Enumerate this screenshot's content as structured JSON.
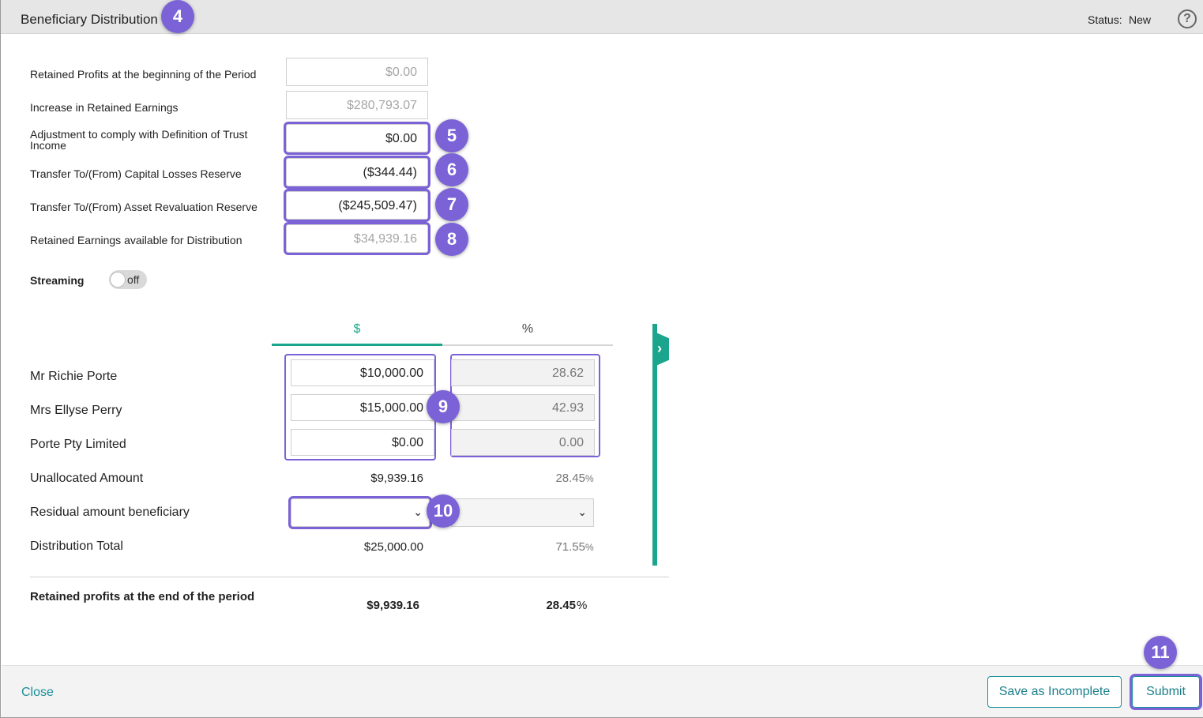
{
  "header": {
    "title": "Beneficiary Distribution",
    "status_label": "Status:",
    "status_value": "New",
    "help_glyph": "?"
  },
  "badges": {
    "b4": "4",
    "b5": "5",
    "b6": "6",
    "b7": "7",
    "b8": "8",
    "b9": "9",
    "b10": "10",
    "b11": "11"
  },
  "summary": {
    "retained_begin_label": "Retained Profits at the beginning of the Period",
    "retained_begin_value": "$0.00",
    "increase_label": "Increase in Retained Earnings",
    "increase_value": "$280,793.07",
    "adjustment_label": "Adjustment to comply with Definition of Trust Income",
    "adjustment_value": "$0.00",
    "capital_losses_label": "Transfer To/(From) Capital Losses Reserve",
    "capital_losses_value": "($344.44)",
    "asset_reval_label": "Transfer To/(From) Asset Revaluation Reserve",
    "asset_reval_value": "($245,509.47)",
    "available_label": "Retained Earnings available for Distribution",
    "available_value": "$34,939.16"
  },
  "streaming": {
    "label": "Streaming",
    "state": "off"
  },
  "tabs": {
    "dollar": "$",
    "percent": "%"
  },
  "beneficiaries": [
    {
      "name": "Mr Richie Porte",
      "amount": "$10,000.00",
      "percent": "28.62"
    },
    {
      "name": "Mrs Ellyse Perry",
      "amount": "$15,000.00",
      "percent": "42.93"
    },
    {
      "name": "Porte Pty Limited",
      "amount": "$0.00",
      "percent": "0.00"
    }
  ],
  "totals": {
    "unallocated_label": "Unallocated Amount",
    "unallocated_amount": "$9,939.16",
    "unallocated_percent": "28.45",
    "residual_label": "Residual amount beneficiary",
    "distribution_label": "Distribution Total",
    "distribution_amount": "$25,000.00",
    "distribution_percent": "71.55",
    "retained_end_label": "Retained profits at the end of the period",
    "retained_end_amount": "$9,939.16",
    "retained_end_percent": "28.45",
    "percent_sign": "%"
  },
  "footer": {
    "close": "Close",
    "save_incomplete": "Save as Incomplete",
    "submit": "Submit"
  },
  "colors": {
    "accent_teal": "#1aa58c",
    "highlight_purple": "#7b62d6",
    "link_teal": "#1a8f9a"
  },
  "icons": {
    "help": "help-circle-icon",
    "expand": "chevron-right-icon",
    "dropdown": "chevron-down-icon"
  }
}
